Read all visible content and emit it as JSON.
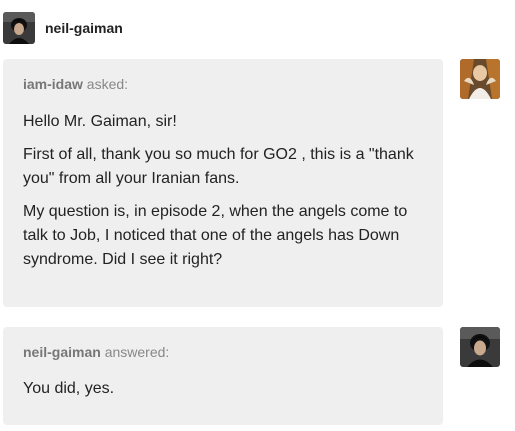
{
  "post": {
    "blog_name": "neil-gaiman"
  },
  "ask": {
    "asker_name": "iam-idaw",
    "asked_label": "asked:",
    "paragraphs": [
      "Hello Mr. Gaiman, sir!",
      "First of all, thank you so much for GO2 , this is a \"thank you\" from all your Iranian fans.",
      "My question is, in episode 2, when the angels come to talk to Job, I noticed that one of the angels has Down syndrome.  Did I see it right?"
    ]
  },
  "answer": {
    "answerer_name": "neil-gaiman",
    "answered_label": "answered:",
    "paragraphs": [
      "You did, yes."
    ]
  },
  "colors": {
    "bubble_background": "#efefef",
    "meta_text": "#888888",
    "body_text": "#222222"
  },
  "icons": {
    "header_avatar": "person-portrait-avatar",
    "asker_avatar": "angel-figure-avatar",
    "answerer_avatar": "person-portrait-avatar"
  }
}
